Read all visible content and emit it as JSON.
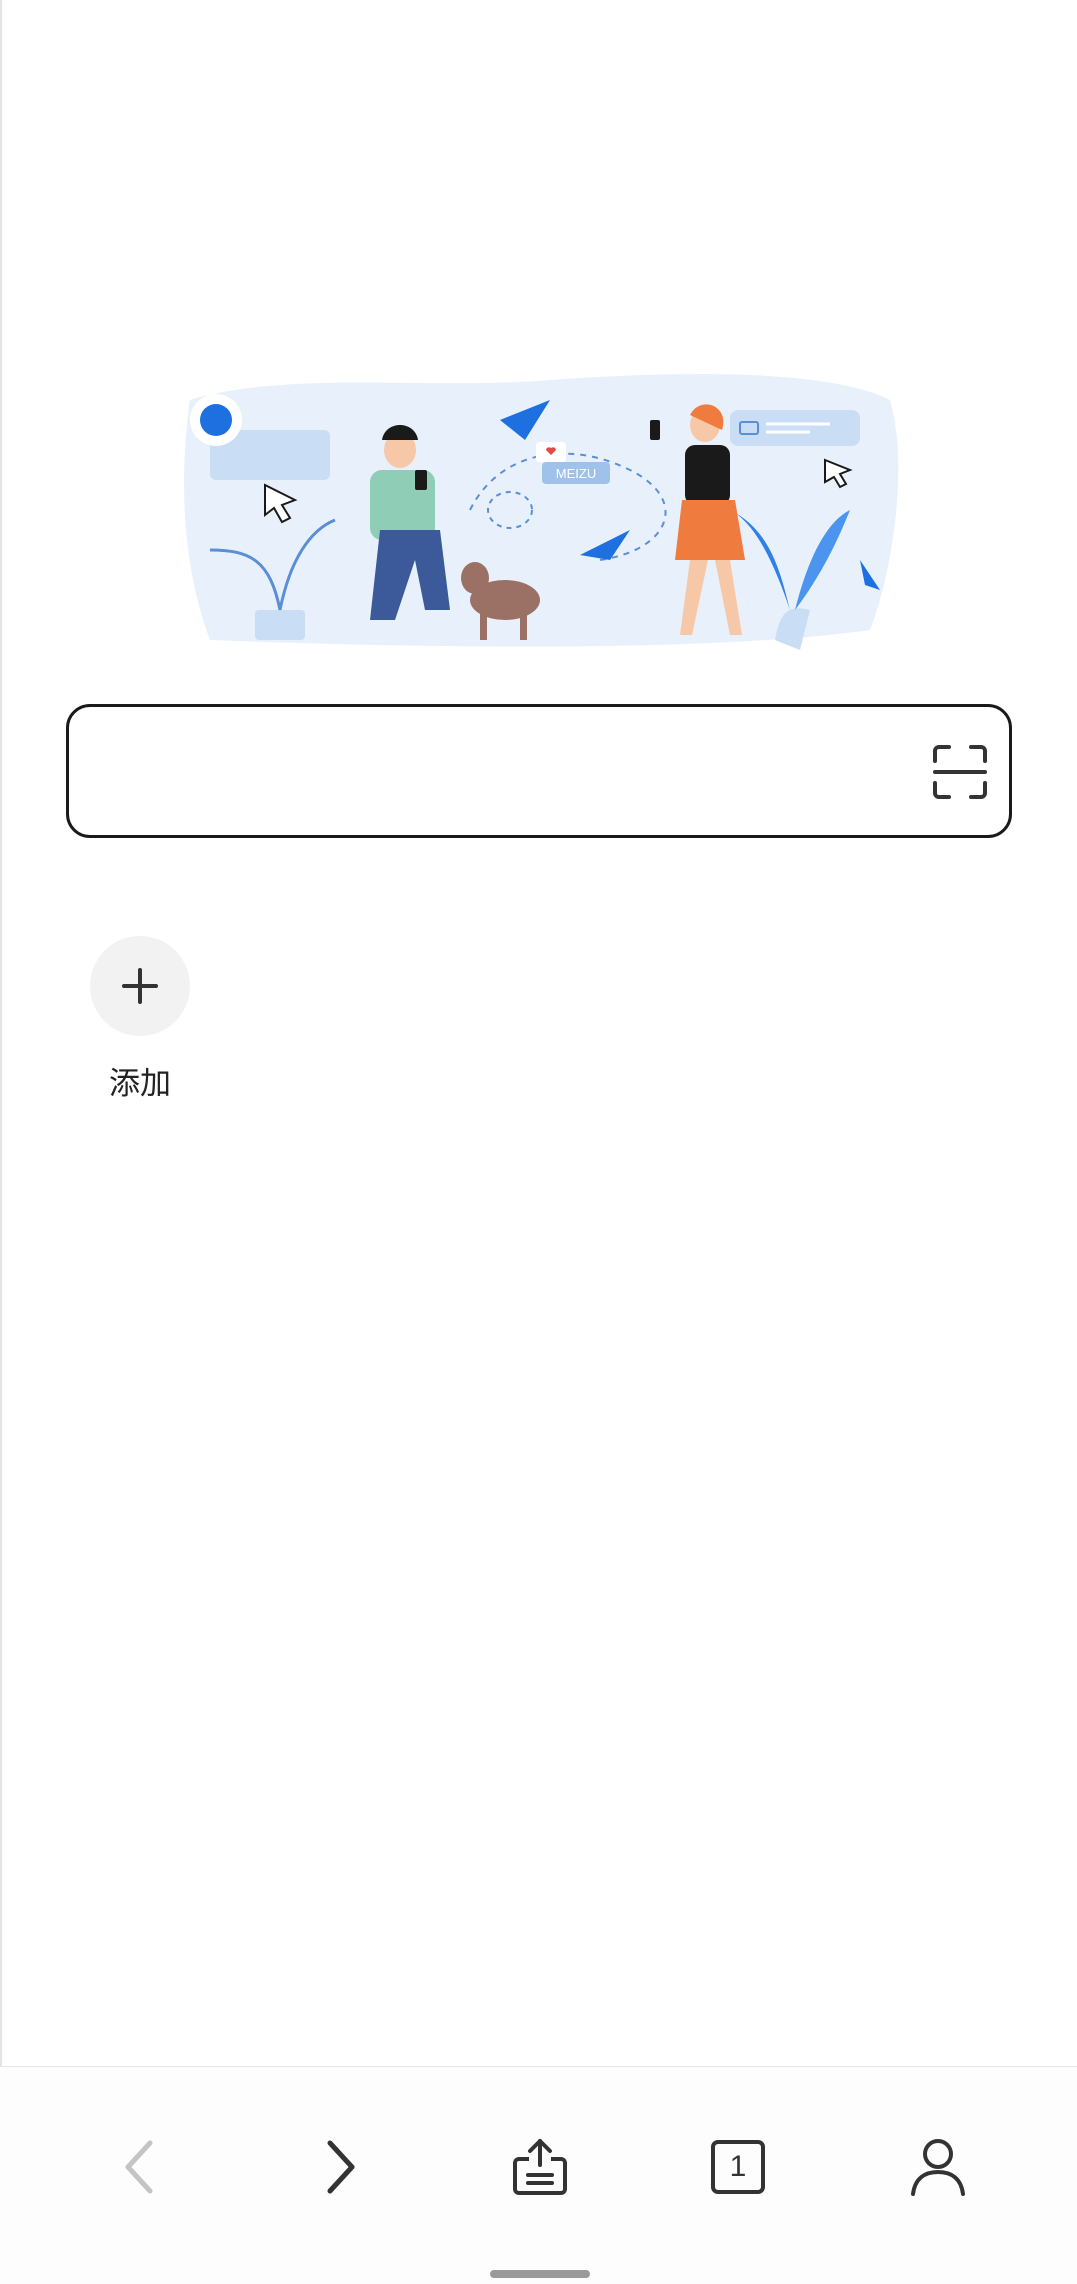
{
  "hero": {
    "brand_text": "MEIZU"
  },
  "search": {
    "value": "",
    "placeholder": ""
  },
  "shortcuts": [
    {
      "label": "添加",
      "icon": "plus-icon"
    }
  ],
  "bottom_nav": {
    "back_icon": "chevron-left-icon",
    "forward_icon": "chevron-right-icon",
    "share_icon": "share-upload-icon",
    "tabs_count": "1",
    "profile_icon": "user-icon"
  },
  "colors": {
    "accent_blue": "#1e6fe0",
    "illustration_light_blue": "#dbe9f8",
    "text_dark": "#222222",
    "icon_disabled": "#c4c4c4"
  }
}
